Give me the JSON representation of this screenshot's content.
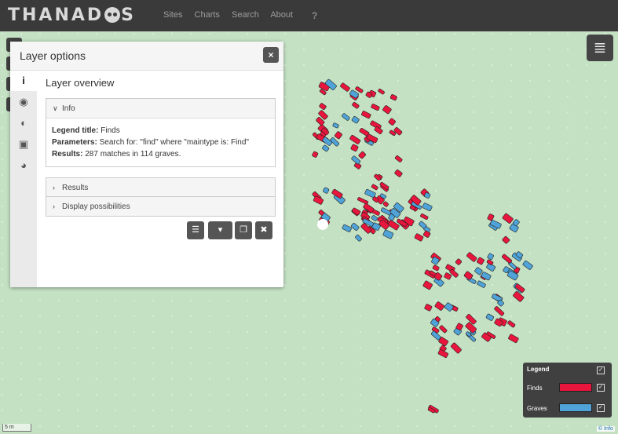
{
  "brand": {
    "text": "THANADOS"
  },
  "nav": {
    "sites": "Sites",
    "charts": "Charts",
    "search": "Search",
    "about": "About",
    "help": "?"
  },
  "panel": {
    "title": "Layer options",
    "close": "×",
    "heading": "Layer overview",
    "info_header": "Info",
    "legend_title_label": "Legend title:",
    "legend_title_value": "Finds",
    "parameters_label": "Parameters:",
    "parameters_value": "Search for: \"find\" where \"maintype is: Find\"",
    "results_label": "Results:",
    "results_value": "287 matches in 114 graves.",
    "results_section": "Results",
    "display_section": "Display possibilities"
  },
  "legend": {
    "title": "Legend",
    "items": [
      {
        "label": "Finds",
        "color": "#e8163c"
      },
      {
        "label": "Graves",
        "color": "#4fa3d8"
      }
    ]
  },
  "scale": "5 m",
  "attribution": "© Info",
  "colors": {
    "finds": "#e8163c",
    "graves": "#4fa3d8",
    "navbar": "#3a3a3a"
  }
}
